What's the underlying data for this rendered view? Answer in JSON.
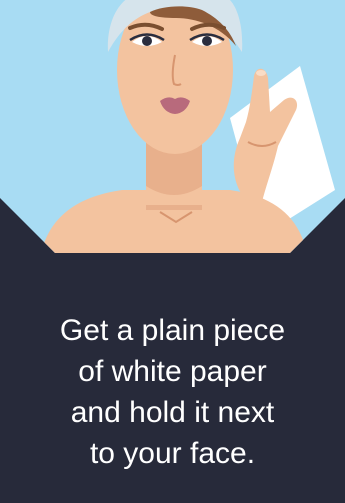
{
  "illustration": {
    "icon": "woman-holding-paper-icon",
    "colors": {
      "background": "#272a3a",
      "sky": "#a8dcf3",
      "skin": "#f3c39f",
      "towel": "#d6e4ec",
      "lips": "#b86a7c",
      "paper": "#ffffff"
    }
  },
  "instruction": {
    "lines": [
      "Get a plain piece",
      "of white paper",
      "and hold it next",
      "to your face."
    ]
  }
}
